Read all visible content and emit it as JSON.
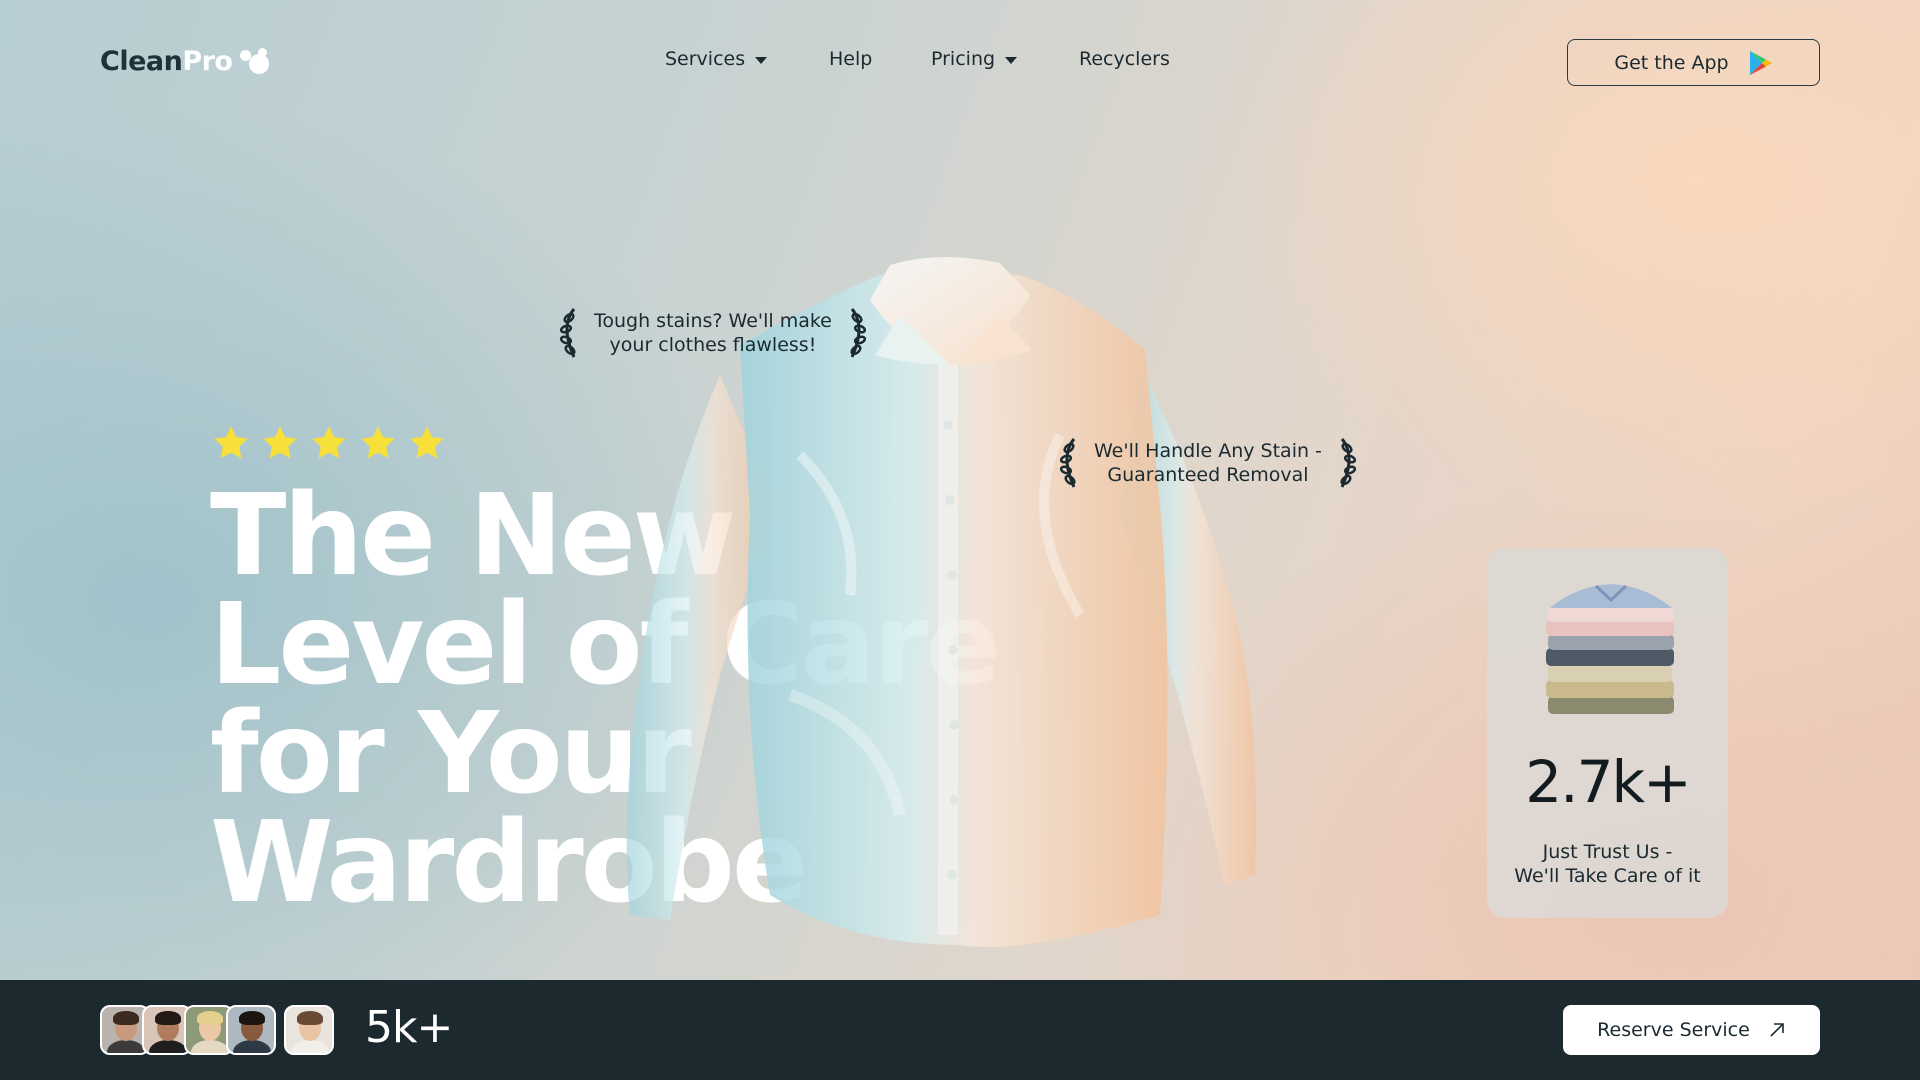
{
  "header": {
    "logo": {
      "part1": "Clean",
      "part2": "Pro"
    },
    "nav": [
      {
        "label": "Services",
        "has_dropdown": true
      },
      {
        "label": "Help",
        "has_dropdown": false
      },
      {
        "label": "Pricing",
        "has_dropdown": true
      },
      {
        "label": "Recyclers",
        "has_dropdown": false
      }
    ],
    "get_app_label": "Get the App",
    "get_app_icon": "google-play-icon"
  },
  "hero": {
    "rating_stars": 5,
    "star_color": "#f7e03a",
    "headline_lines": [
      "The New",
      "Level of Care",
      "for Your",
      "Wardrobe"
    ],
    "badges": [
      {
        "text_line1": "Tough stains? We'll make",
        "text_line2": "your clothes flawless!"
      },
      {
        "text_line1": "We'll Handle Any Stain -",
        "text_line2": "Guaranteed Removal"
      }
    ]
  },
  "stat_card": {
    "value": "2.7k+",
    "caption_line1": "Just Trust Us -",
    "caption_line2": "We'll Take Care of it"
  },
  "bottom_bar": {
    "user_count": "5k+",
    "reserve_label": "Reserve Service",
    "reserve_icon": "arrow-up-right-icon"
  },
  "colors": {
    "dark": "#1c292e",
    "white": "#ffffff",
    "star": "#f7e03a"
  }
}
